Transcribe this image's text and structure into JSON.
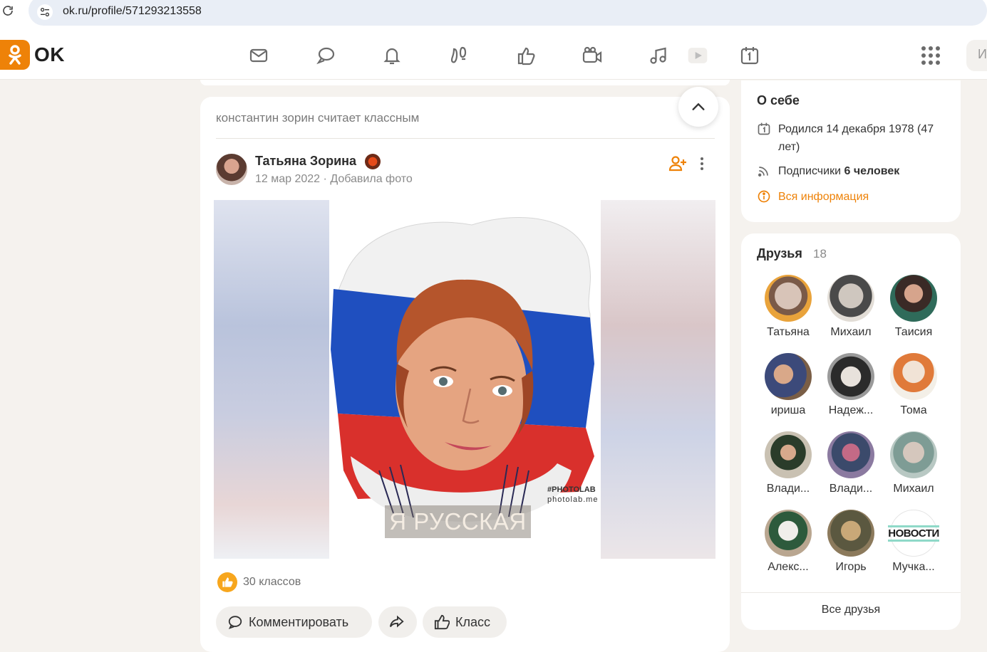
{
  "browser": {
    "url": "ok.ru/profile/571293213558"
  },
  "header": {
    "logo_text": "OK",
    "nav": [
      {
        "name": "messages-icon"
      },
      {
        "name": "discussions-icon"
      },
      {
        "name": "notifications-icon"
      },
      {
        "name": "guests-icon"
      },
      {
        "name": "likes-icon"
      },
      {
        "name": "video-calls-icon"
      },
      {
        "name": "music-icon"
      },
      {
        "name": "video-icon"
      },
      {
        "name": "calendar-icon"
      }
    ],
    "search_stub": "И"
  },
  "feed": {
    "liked_by": "константин зорин считает классным",
    "post": {
      "author": "Татьяна Зорина",
      "date": "12 мар 2022",
      "meta_separator": "·",
      "action": "Добавила фото",
      "photo_watermark_1": "#PHOTOLAB",
      "photo_watermark_2": "photolab.me",
      "photo_caption": "Я РУССКАЯ",
      "likes_text": "30 классов",
      "buttons": {
        "comment": "Комментировать",
        "like": "Класс"
      }
    }
  },
  "sidebar": {
    "about": {
      "title": "О себе",
      "birth_line1": "Родился 14 декабря 1978 (47",
      "birth_line2": "лет)",
      "subscribers_label": "Подписчики",
      "subscribers_value": "6 человек",
      "all_info": "Вся информация"
    },
    "friends": {
      "title": "Друзья",
      "count": "18",
      "items": [
        {
          "name": "Татьяна"
        },
        {
          "name": "Михаил"
        },
        {
          "name": "Таисия"
        },
        {
          "name": "ириша"
        },
        {
          "name": "Надеж..."
        },
        {
          "name": "Тома"
        },
        {
          "name": "Влади..."
        },
        {
          "name": "Влади..."
        },
        {
          "name": "Михаил"
        },
        {
          "name": "Алекс..."
        },
        {
          "name": "Игорь"
        },
        {
          "name": "Мучка..."
        }
      ],
      "all_label": "Все друзья"
    }
  },
  "colors": {
    "brand_orange": "#ee8208",
    "page_bg": "#f5f2ee",
    "flag_white": "#ffffff",
    "flag_blue": "#1f4fbf",
    "flag_red": "#d9302c"
  }
}
